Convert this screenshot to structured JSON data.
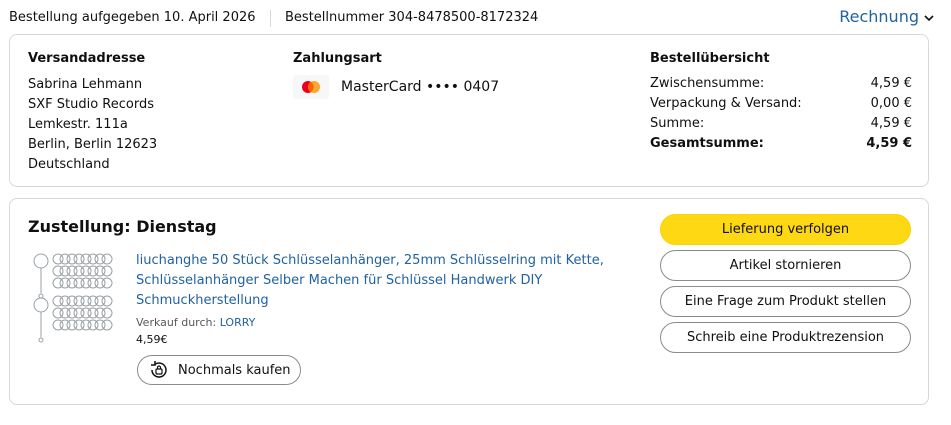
{
  "header": {
    "placed": "Bestellung aufgegeben 10. April 2026",
    "order_number": "Bestellnummer 304-8478500-8172324",
    "invoice_label": "Rechnung"
  },
  "shipping": {
    "heading": "Versandadresse",
    "lines": [
      "Sabrina Lehmann",
      "SXF Studio Records",
      "Lemkestr. 111a",
      "Berlin, Berlin 12623",
      "Deutschland"
    ]
  },
  "payment": {
    "heading": "Zahlungsart",
    "card_text": "MasterCard •••• 0407",
    "icon": "mastercard-icon"
  },
  "summary": {
    "heading": "Bestellübersicht",
    "rows": [
      {
        "label": "Zwischensumme:",
        "value": "4,59 €"
      },
      {
        "label": "Verpackung & Versand:",
        "value": "0,00 €"
      },
      {
        "label": "Summe:",
        "value": "4,59 €"
      },
      {
        "label": "Gesamtsumme:",
        "value": "4,59 €"
      }
    ]
  },
  "delivery": {
    "title": "Zustellung: Dienstag",
    "product_title": "liuchanghe 50 Stück Schlüsselanhänger, 25mm Schlüsselring mit Kette, Schlüsselanhänger Selber Machen für Schlüssel Handwerk DIY Schmuckherstellung",
    "seller_prefix": "Verkauf durch:",
    "seller_name": "LORRY",
    "price": "4,59€",
    "buy_again": "Nochmals kaufen"
  },
  "actions": {
    "track": "Lieferung verfolgen",
    "cancel": "Artikel stornieren",
    "question": "Eine Frage zum Produkt stellen",
    "review": "Schreib eine Produktrezension"
  },
  "colors": {
    "link": "#2162a1",
    "primary_button": "#ffd814",
    "border": "#d5d9d9"
  }
}
